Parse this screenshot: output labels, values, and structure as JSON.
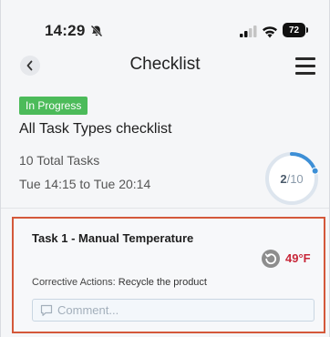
{
  "status_bar": {
    "time": "14:29",
    "battery": "72",
    "icons": [
      "bell-slash-icon",
      "signal-icon",
      "wifi-icon",
      "battery-icon"
    ]
  },
  "nav": {
    "title": "Checklist",
    "back_icon": "chevron-left-icon",
    "menu_icon": "menu-icon"
  },
  "checklist": {
    "status": "In Progress",
    "name": "All Task Types checklist",
    "total_tasks": "10 Total Tasks",
    "time_range": "Tue 14:15 to Tue 20:14",
    "progress": {
      "completed": "2",
      "separator": "/",
      "total": "10",
      "fraction": 0.2,
      "color": "#3d8fd6"
    }
  },
  "task": {
    "title": "Task 1 - Manual Temperature",
    "reading": "49°F",
    "reading_color": "#c8283a",
    "history_icon": "history-icon",
    "corrective_label": "Corrective Actions:",
    "corrective_value": "Recycle the product",
    "comment_placeholder": "Comment...",
    "highlight_color": "#d4583a"
  },
  "colors": {
    "badge": "#4cbb5a",
    "accent": "#3d8fd6"
  }
}
